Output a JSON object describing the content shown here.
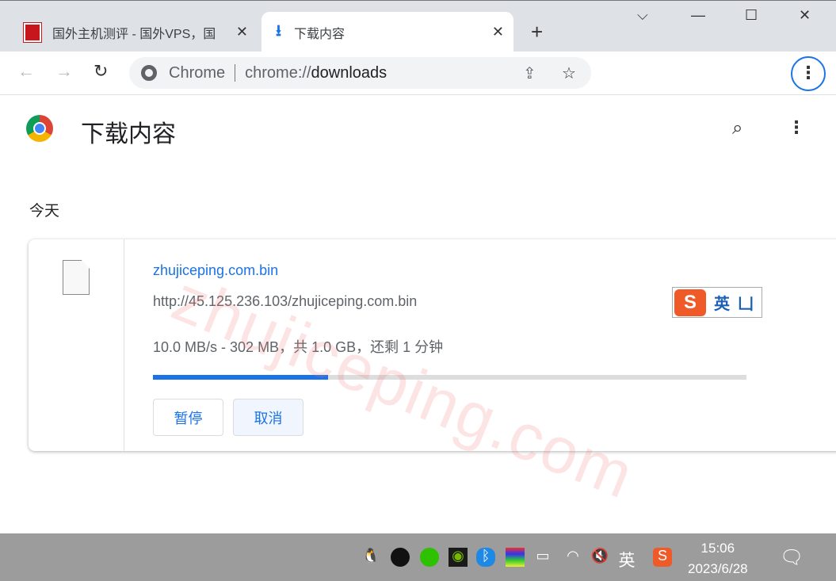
{
  "tabs": [
    {
      "title": "国外主机测评 - 国外VPS，国",
      "close": "✕",
      "icon": "site-favicon"
    },
    {
      "title": "下载内容",
      "close": "✕",
      "icon": "download-icon"
    }
  ],
  "new_tab": "+",
  "window": {
    "minimize": "—",
    "maximize": "☐",
    "close": "✕",
    "tab_search": "⌵"
  },
  "omnibox": {
    "origin": "Chrome",
    "url_prefix": "chrome://",
    "url_path": "downloads"
  },
  "page": {
    "title": "下载内容",
    "section": "今天"
  },
  "download": {
    "filename": "zhujiceping.com.bin",
    "url": "http://45.125.236.103/zhujiceping.com.bin",
    "status": "10.0 MB/s - 302 MB，共 1.0 GB，还剩 1 分钟",
    "progress_percent": 29.5,
    "pause": "暂停",
    "cancel": "取消"
  },
  "watermark": "zhujiceping.com",
  "ime": {
    "logo": "S",
    "mode": "英",
    "extra": "⼐"
  },
  "taskbar": {
    "ime_lang": "英",
    "time": "15:06",
    "date": "2023/6/28"
  },
  "colors": {
    "accent": "#1a73e8",
    "taskbar": "#9c9c9c"
  }
}
